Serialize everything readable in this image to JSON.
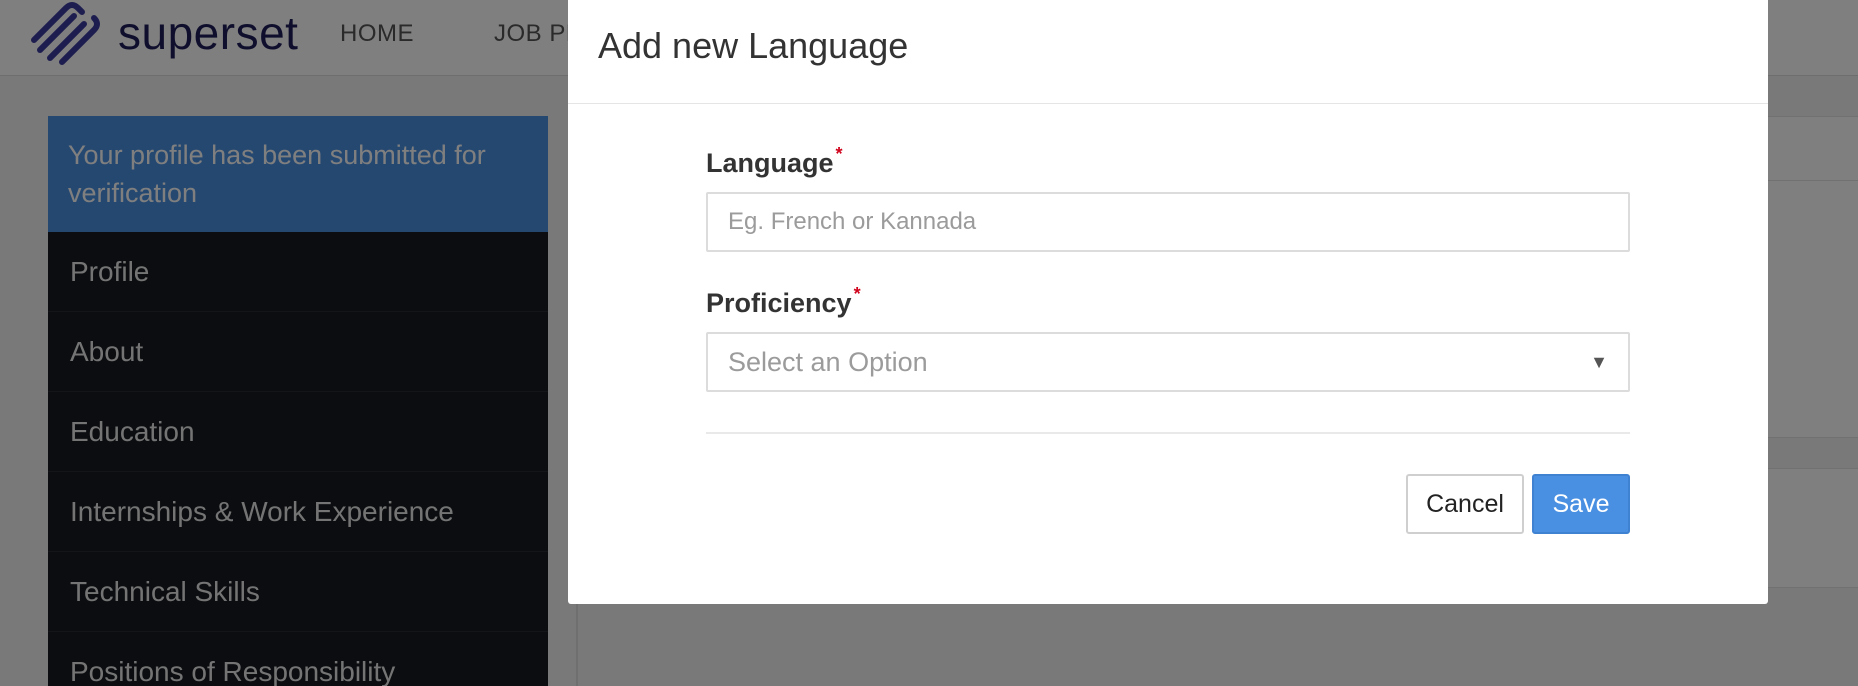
{
  "app": {
    "brand": "superset"
  },
  "nav": {
    "items": [
      "HOME",
      "JOB PROFILES"
    ]
  },
  "sidebar": {
    "notice": "Your profile has been submitted for verification",
    "items": [
      "Profile",
      "About",
      "Education",
      "Internships & Work Experience",
      "Technical Skills",
      "Positions of Responsibility"
    ]
  },
  "modal": {
    "title": "Add new Language",
    "language": {
      "label": "Language",
      "required": "*",
      "placeholder": "Eg. French or Kannada",
      "value": ""
    },
    "proficiency": {
      "label": "Proficiency",
      "required": "*",
      "selected": "Select an Option"
    },
    "cancel_label": "Cancel",
    "save_label": "Save"
  },
  "colors": {
    "brand": "#1e1e5a",
    "notice_bg": "#4a90e2",
    "sidebar_bg": "#161a20",
    "primary_button": "#4a90e2",
    "required_marker": "#d0021b"
  },
  "icons": {
    "logo": "superset-logo-icon",
    "dropdown": "chevron-down-icon"
  }
}
